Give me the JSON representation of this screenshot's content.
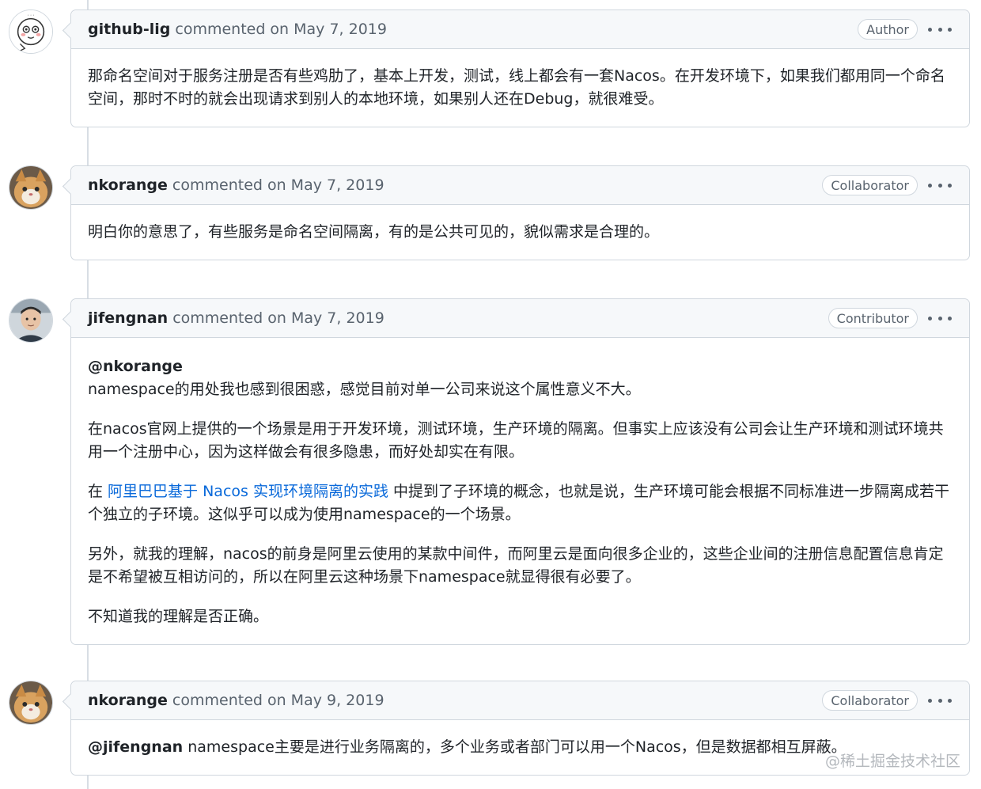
{
  "comments": [
    {
      "author": "github-lig",
      "meta": "commented on May 7, 2019",
      "badge": "Author",
      "avatar": "sketch-avatar-icon",
      "paragraphs": [
        "那命名空间对于服务注册是否有些鸡肋了，基本上开发，测试，线上都会有一套Nacos。在开发环境下，如果我们都用同一个命名空间，那时不时的就会出现请求到别人的本地环境，如果别人还在Debug，就很难受。"
      ]
    },
    {
      "author": "nkorange",
      "meta": "commented on May 7, 2019",
      "badge": "Collaborator",
      "avatar": "cat-avatar-icon",
      "paragraphs": [
        "明白你的意思了，有些服务是命名空间隔离，有的是公共可见的，貌似需求是合理的。"
      ]
    },
    {
      "author": "jifengnan",
      "meta": "commented on May 7, 2019",
      "badge": "Contributor",
      "avatar": "person-avatar-icon",
      "mention": "@nkorange",
      "line1": "namespace的用处我也感到很困惑，感觉目前对单一公司来说这个属性意义不大。",
      "p2": "在nacos官网上提供的一个场景是用于开发环境，测试环境，生产环境的隔离。但事实上应该没有公司会让生产环境和测试环境共用一个注册中心，因为这样做会有很多隐患，而好处却实在有限。",
      "p3_prefix": "在 ",
      "p3_link": "阿里巴巴基于 Nacos 实现环境隔离的实践",
      "p3_suffix": " 中提到了子环境的概念，也就是说，生产环境可能会根据不同标准进一步隔离成若干个独立的子环境。这似乎可以成为使用namespace的一个场景。",
      "p4": "另外，就我的理解，nacos的前身是阿里云使用的某款中间件，而阿里云是面向很多企业的，这些企业间的注册信息配置信息肯定是不希望被互相访问的，所以在阿里云这种场景下namespace就显得很有必要了。",
      "p5": "不知道我的理解是否正确。"
    },
    {
      "author": "nkorange",
      "meta": "commented on May 9, 2019",
      "badge": "Collaborator",
      "avatar": "cat-avatar-icon",
      "mention": "@jifengnan",
      "text": " namespace主要是进行业务隔离的，多个业务或者部门可以用一个Nacos，但是数据都相互屏蔽。"
    }
  ],
  "watermark": "@稀土掘金技术社区",
  "colors": {
    "link": "#0969da",
    "border": "#d0d7de",
    "header_bg": "#f6f8fa",
    "muted": "#59636e"
  }
}
